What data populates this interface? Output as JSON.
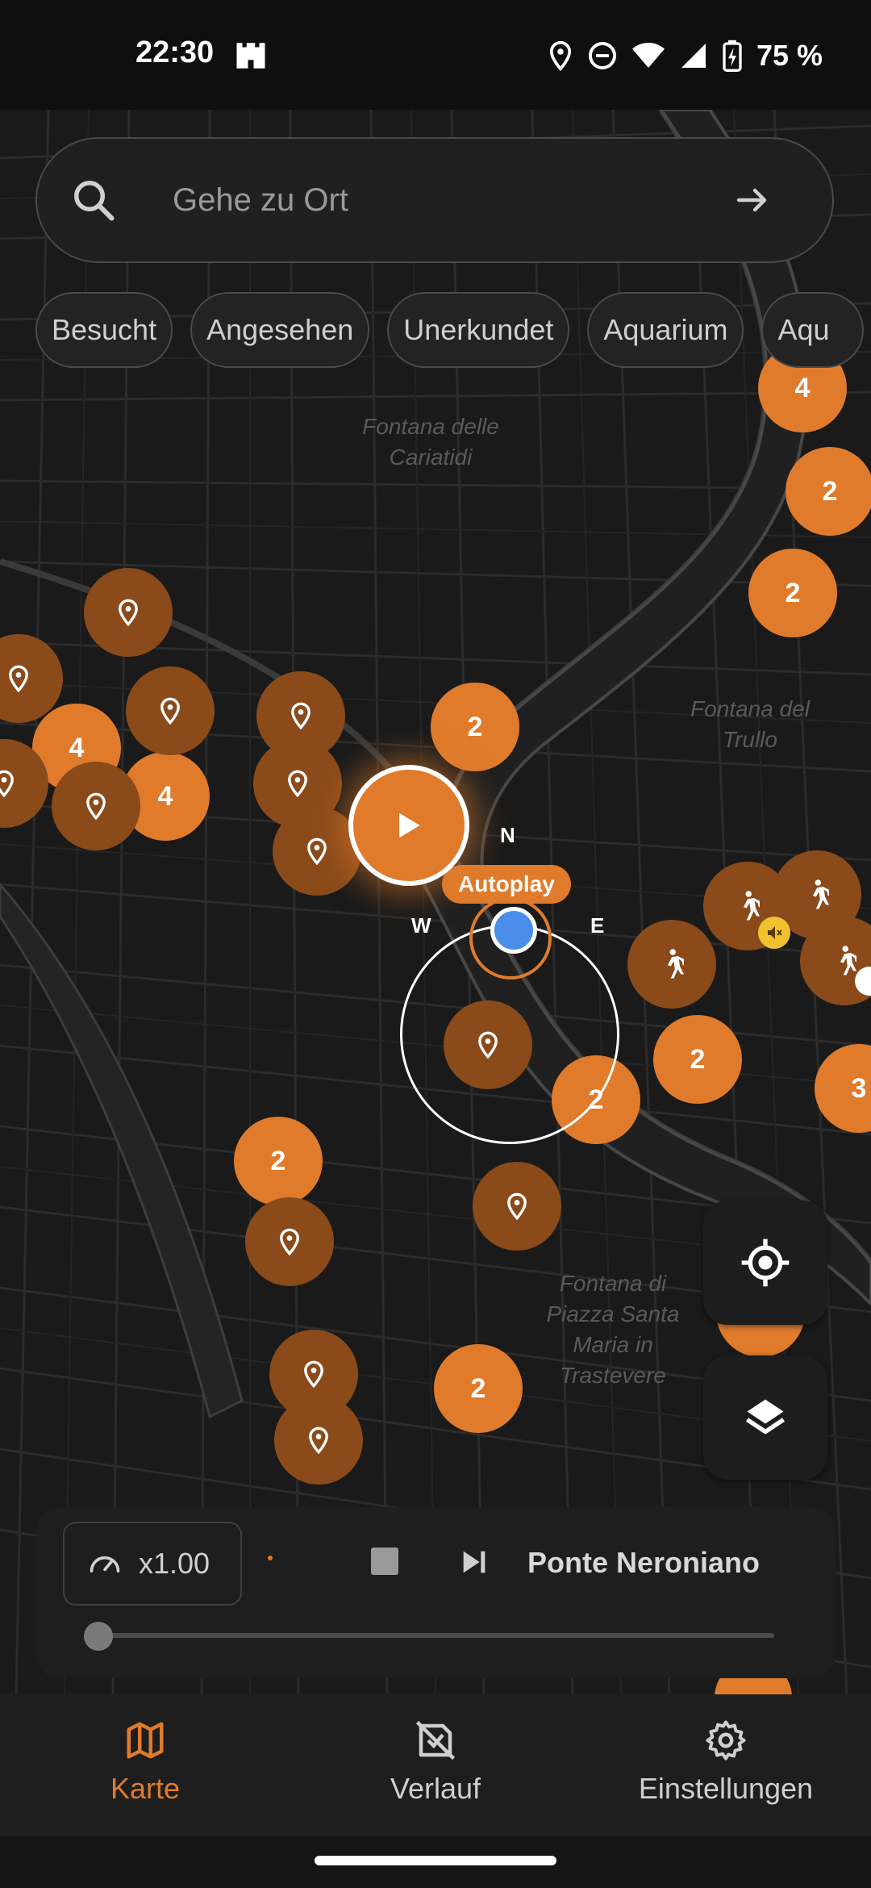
{
  "status_bar": {
    "time": "22:30",
    "battery": "75 %"
  },
  "search": {
    "placeholder": "Gehe zu Ort"
  },
  "chips": [
    "Besucht",
    "Angesehen",
    "Unerkundet",
    "Aquarium",
    "Aqu"
  ],
  "map": {
    "labels": [
      "Fontana delle\nCariatidi",
      "Fontana del\nTrullo",
      "Fontana di\nPiazza Santa\nMaria in\nTrastevere"
    ],
    "clusters": [
      "4",
      "2",
      "2",
      "4",
      "4",
      "2",
      "2",
      "2",
      "2",
      "2",
      "3",
      "2"
    ],
    "compass": {
      "n": "N",
      "w": "W",
      "e": "E"
    },
    "autoplay_label": "Autoplay"
  },
  "player": {
    "speed": "x1.00",
    "track_title": "Ponte Neroniano",
    "progress": 0.0
  },
  "bottom_nav": {
    "items": [
      {
        "label": "Karte",
        "icon": "map-icon",
        "active": true
      },
      {
        "label": "Verlauf",
        "icon": "history-icon",
        "active": false
      },
      {
        "label": "Einstellungen",
        "icon": "gear-icon",
        "active": false
      }
    ]
  },
  "colors": {
    "accent": "#e07b2c",
    "poi": "#8a4a1a",
    "location": "#4a8eea"
  }
}
